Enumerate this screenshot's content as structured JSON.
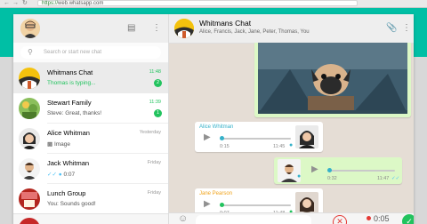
{
  "browser": {
    "url_scheme": "https://",
    "url_host": "web.whatsapp.com",
    "icons": [
      "back-icon",
      "forward-icon",
      "reload-icon",
      "lock-icon"
    ]
  },
  "sidebar": {
    "search_placeholder": "Search or start new chat",
    "chats": [
      {
        "name": "Whitmans Chat",
        "time": "11:48",
        "message": "Thomas is typing...",
        "unread": "2",
        "typing": true,
        "active": true
      },
      {
        "name": "Stewart Family",
        "time": "11:39",
        "message": "Steve: Great, thanks!",
        "unread": "1",
        "typing": false,
        "active": false
      },
      {
        "name": "Alice Whitman",
        "time": "Yesterday",
        "message": "Image",
        "unread": "",
        "typing": false,
        "active": false
      },
      {
        "name": "Jack Whitman",
        "time": "Friday",
        "message": "0:07",
        "unread": "",
        "typing": false,
        "active": false
      },
      {
        "name": "Lunch Group",
        "time": "Friday",
        "message": "You: Sounds good!",
        "unread": "",
        "typing": false,
        "active": false
      }
    ]
  },
  "chat": {
    "title": "Whitmans Chat",
    "members": "Alice, Francis, Jack, Jane, Peter, Thomas, You",
    "voice_messages": [
      {
        "sender": "Alice Whitman",
        "duration": "0:15",
        "time": "11:45"
      },
      {
        "sender": "",
        "duration": "0:32",
        "time": "11:47"
      },
      {
        "sender": "Jane Pearson",
        "duration": "0:07",
        "time": "11:48"
      }
    ],
    "recording_time": "0:05"
  },
  "colors": {
    "teal": "#00bfa5",
    "green": "#22c35e",
    "alice": "#35b1c9",
    "jane": "#f0a31b",
    "record_red": "#e53935"
  }
}
